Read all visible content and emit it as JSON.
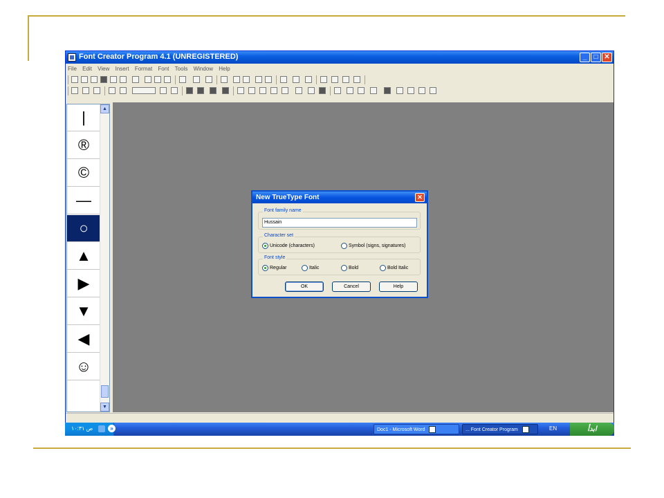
{
  "window": {
    "title": "Font Creator Program 4.1 (UNREGISTERED)",
    "controls": {
      "minimize": "_",
      "maximize": "□",
      "close": "✕"
    }
  },
  "menu": [
    "File",
    "Edit",
    "View",
    "Insert",
    "Format",
    "Font",
    "Tools",
    "Window",
    "Help"
  ],
  "glyphs": [
    "|",
    "®",
    "©",
    "—",
    "○",
    "▲",
    "▶",
    "▼",
    "◀",
    "☺"
  ],
  "scroll": {
    "up": "▲",
    "down": "▼"
  },
  "dialog": {
    "title": "New TrueType Font",
    "close": "✕",
    "family_label": "Font family name",
    "family_value": "Hussain",
    "charset_label": "Character set",
    "charset_options": [
      "Unicode (characters)",
      "Symbol (signs, signatures)"
    ],
    "charset_selected": "Unicode (characters)",
    "style_label": "Font style",
    "style_options": [
      "Regular",
      "Italic",
      "Bold",
      "Bold Italic"
    ],
    "style_selected": "Regular",
    "buttons": {
      "ok": "OK",
      "cancel": "Cancel",
      "help": "Help"
    }
  },
  "taskbar": {
    "clock": "۱۰:۳۱ ص",
    "tasks": [
      "Doc1 - Microsoft Word",
      "... Font Creator Program"
    ],
    "language": "EN",
    "start_label": "ابدأ"
  }
}
